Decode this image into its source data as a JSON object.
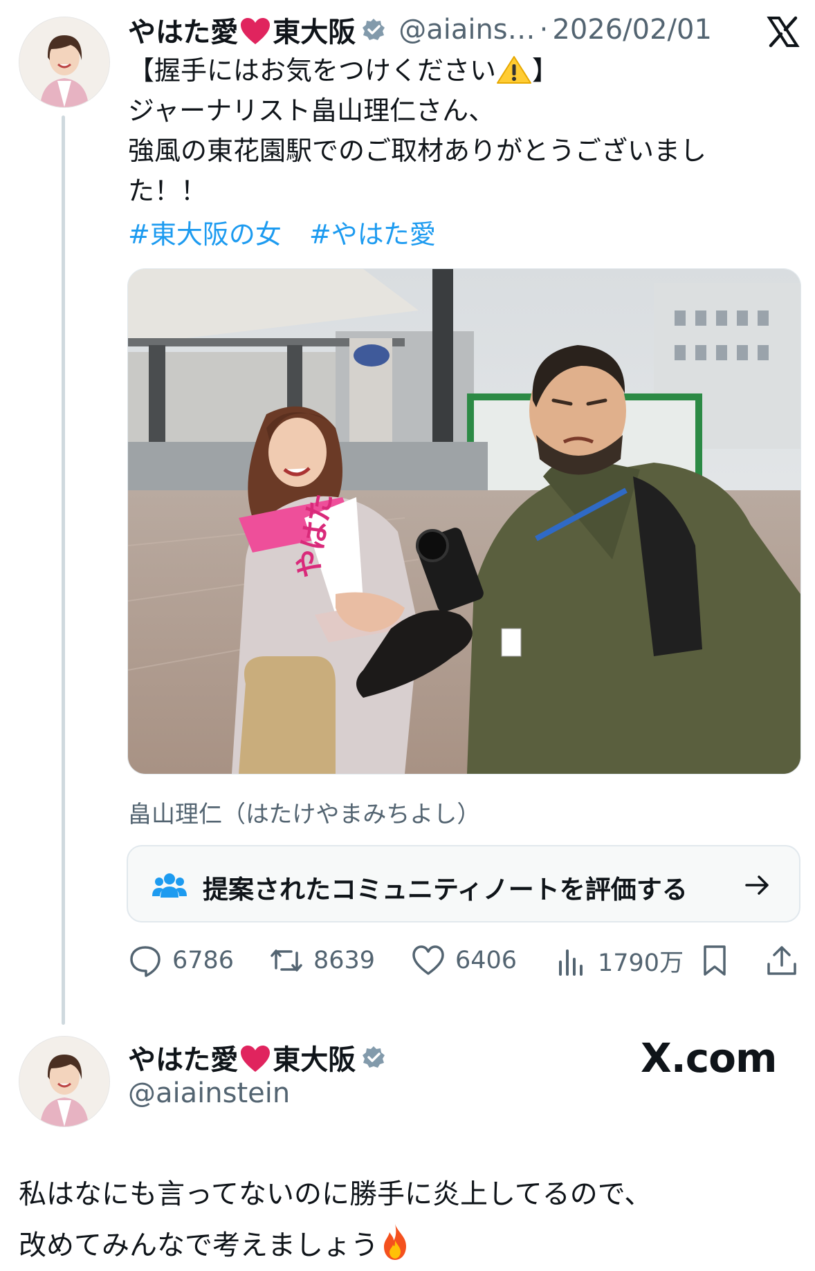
{
  "tweet": {
    "author_name_part1": "やはた愛",
    "author_name_part2": "東大阪",
    "handle": "@aiains…",
    "separator": "·",
    "date": "2026/02/01",
    "text_line1": "【握手にはお気をつけください",
    "text_line1_end": "】",
    "text_line2": "ジャーナリスト畠山理仁さん、",
    "text_line3": "強風の東花園駅でのご取材ありがとうございまし",
    "text_line4": "た！！",
    "hashtags": [
      "#東大阪の女",
      "#やはた愛"
    ],
    "photo_sign": "やはた",
    "photo_caption": "畠山理仁（はたけやまみちよし）",
    "community_note_label": "提案されたコミュニティノートを評価する",
    "metrics": {
      "replies": "6786",
      "reposts": "8639",
      "likes": "6406",
      "views": "1790万"
    }
  },
  "profile": {
    "name_part1": "やはた愛",
    "name_part2": "東大阪",
    "handle": "@aiainstein",
    "brand": "X.com"
  },
  "reply": {
    "line1": "私はなにも言ってないのに勝手に炎上してるので、",
    "line2": "改めてみんなで考えましょう"
  },
  "icons": [
    "x-logo-icon",
    "verified-badge-icon",
    "heart-emoji-icon",
    "warning-emoji-icon",
    "community-icon",
    "arrow-right-icon",
    "reply-icon",
    "repost-icon",
    "like-icon",
    "views-icon",
    "bookmark-icon",
    "share-icon",
    "fire-emoji-icon"
  ],
  "colors": {
    "hashtag": "#1d9bf0",
    "secondary_text": "#536471",
    "verified": "#829aab",
    "heart": "#e0245e"
  }
}
